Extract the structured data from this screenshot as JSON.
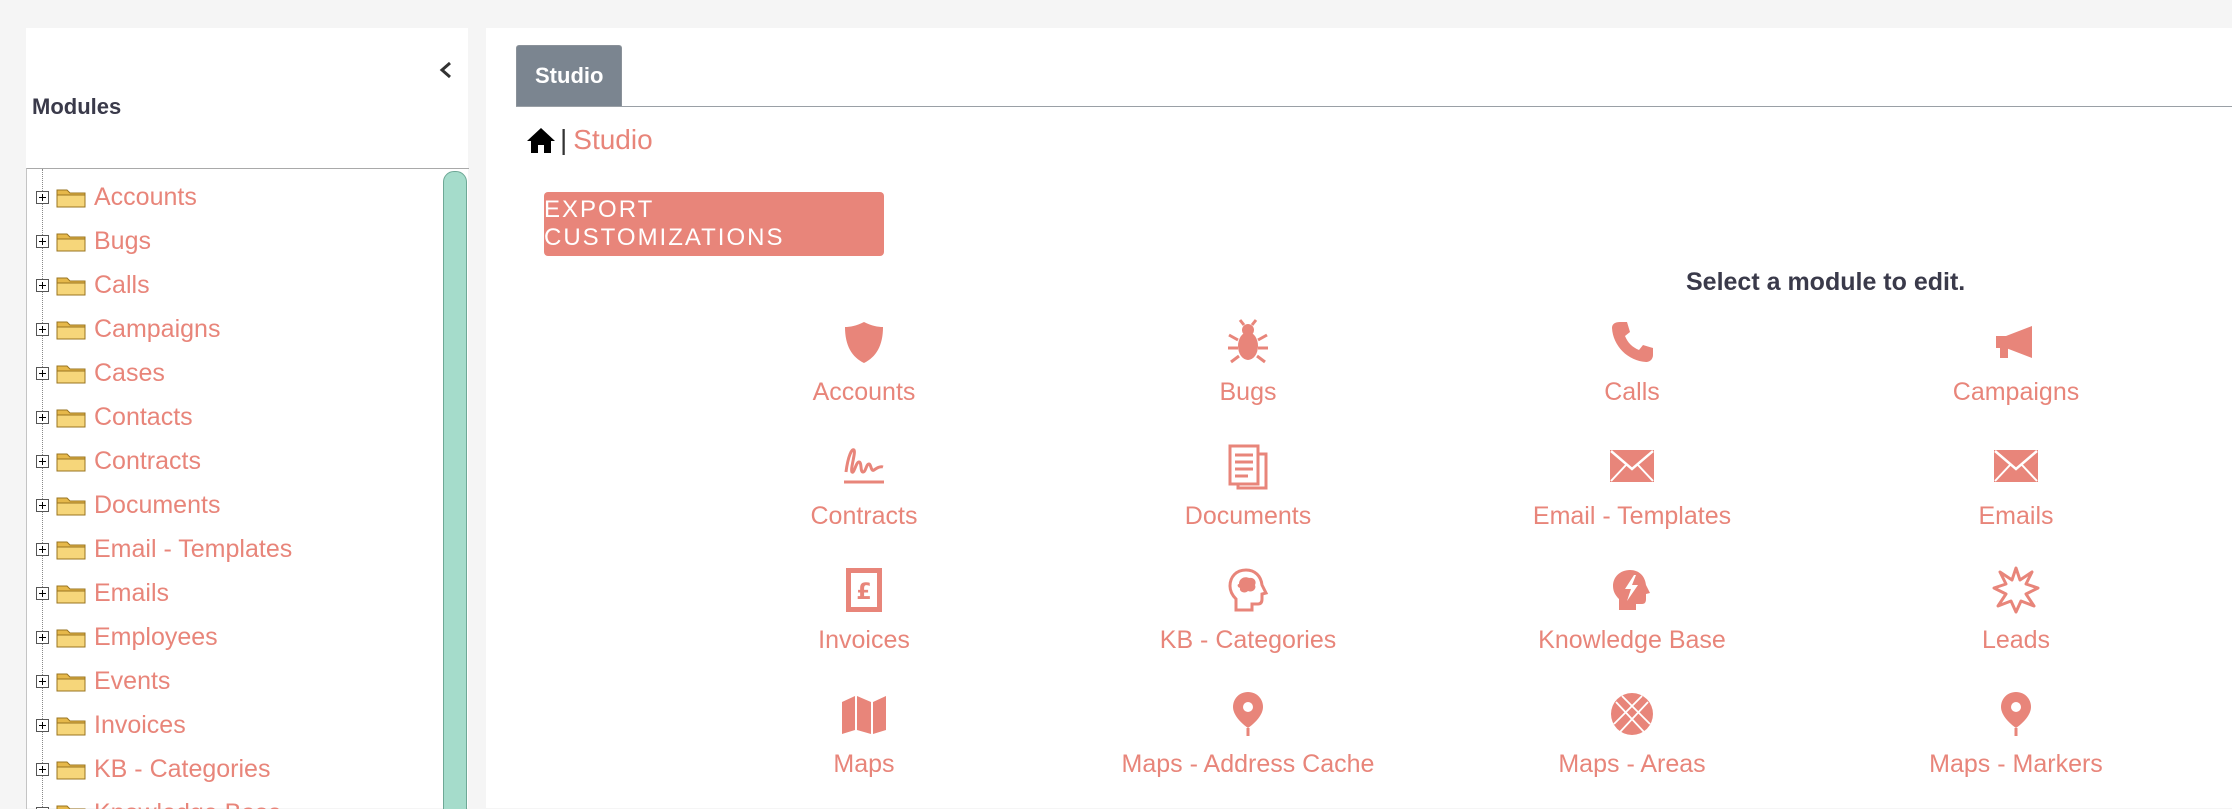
{
  "sidebar": {
    "title": "Modules",
    "collapse_icon": "chevron-left-icon",
    "items": [
      {
        "label": "Accounts"
      },
      {
        "label": "Bugs"
      },
      {
        "label": "Calls"
      },
      {
        "label": "Campaigns"
      },
      {
        "label": "Cases"
      },
      {
        "label": "Contacts"
      },
      {
        "label": "Contracts"
      },
      {
        "label": "Documents"
      },
      {
        "label": "Email - Templates"
      },
      {
        "label": "Emails"
      },
      {
        "label": "Employees"
      },
      {
        "label": "Events"
      },
      {
        "label": "Invoices"
      },
      {
        "label": "KB - Categories"
      },
      {
        "label": "Knowledge Base"
      }
    ]
  },
  "tabs": [
    {
      "label": "Studio"
    }
  ],
  "breadcrumb": {
    "home_icon": "home-icon",
    "separator": "|",
    "current": "Studio"
  },
  "toolbar": {
    "export_label": "EXPORT CUSTOMIZATIONS"
  },
  "main": {
    "instruction": "Select a module to edit.",
    "modules": [
      {
        "label": "Accounts",
        "icon": "shield-icon"
      },
      {
        "label": "Bugs",
        "icon": "bug-icon"
      },
      {
        "label": "Calls",
        "icon": "phone-icon"
      },
      {
        "label": "Campaigns",
        "icon": "megaphone-icon"
      },
      {
        "label": "Contracts",
        "icon": "signature-icon"
      },
      {
        "label": "Documents",
        "icon": "document-icon"
      },
      {
        "label": "Email - Templates",
        "icon": "envelope-icon"
      },
      {
        "label": "Emails",
        "icon": "envelope-icon"
      },
      {
        "label": "Invoices",
        "icon": "invoice-pound-icon"
      },
      {
        "label": "KB - Categories",
        "icon": "head-brain-icon"
      },
      {
        "label": "Knowledge Base",
        "icon": "head-lightning-icon"
      },
      {
        "label": "Leads",
        "icon": "starburst-icon"
      },
      {
        "label": "Maps",
        "icon": "map-icon"
      },
      {
        "label": "Maps - Address Cache",
        "icon": "map-pin-icon"
      },
      {
        "label": "Maps - Areas",
        "icon": "globe-grid-icon"
      },
      {
        "label": "Maps - Markers",
        "icon": "map-pin-icon"
      }
    ]
  },
  "colors": {
    "accent": "#e8857a",
    "tab_bg": "#7b8590",
    "scrollbar": "#a5dccb",
    "heading": "#3a3a4a"
  }
}
